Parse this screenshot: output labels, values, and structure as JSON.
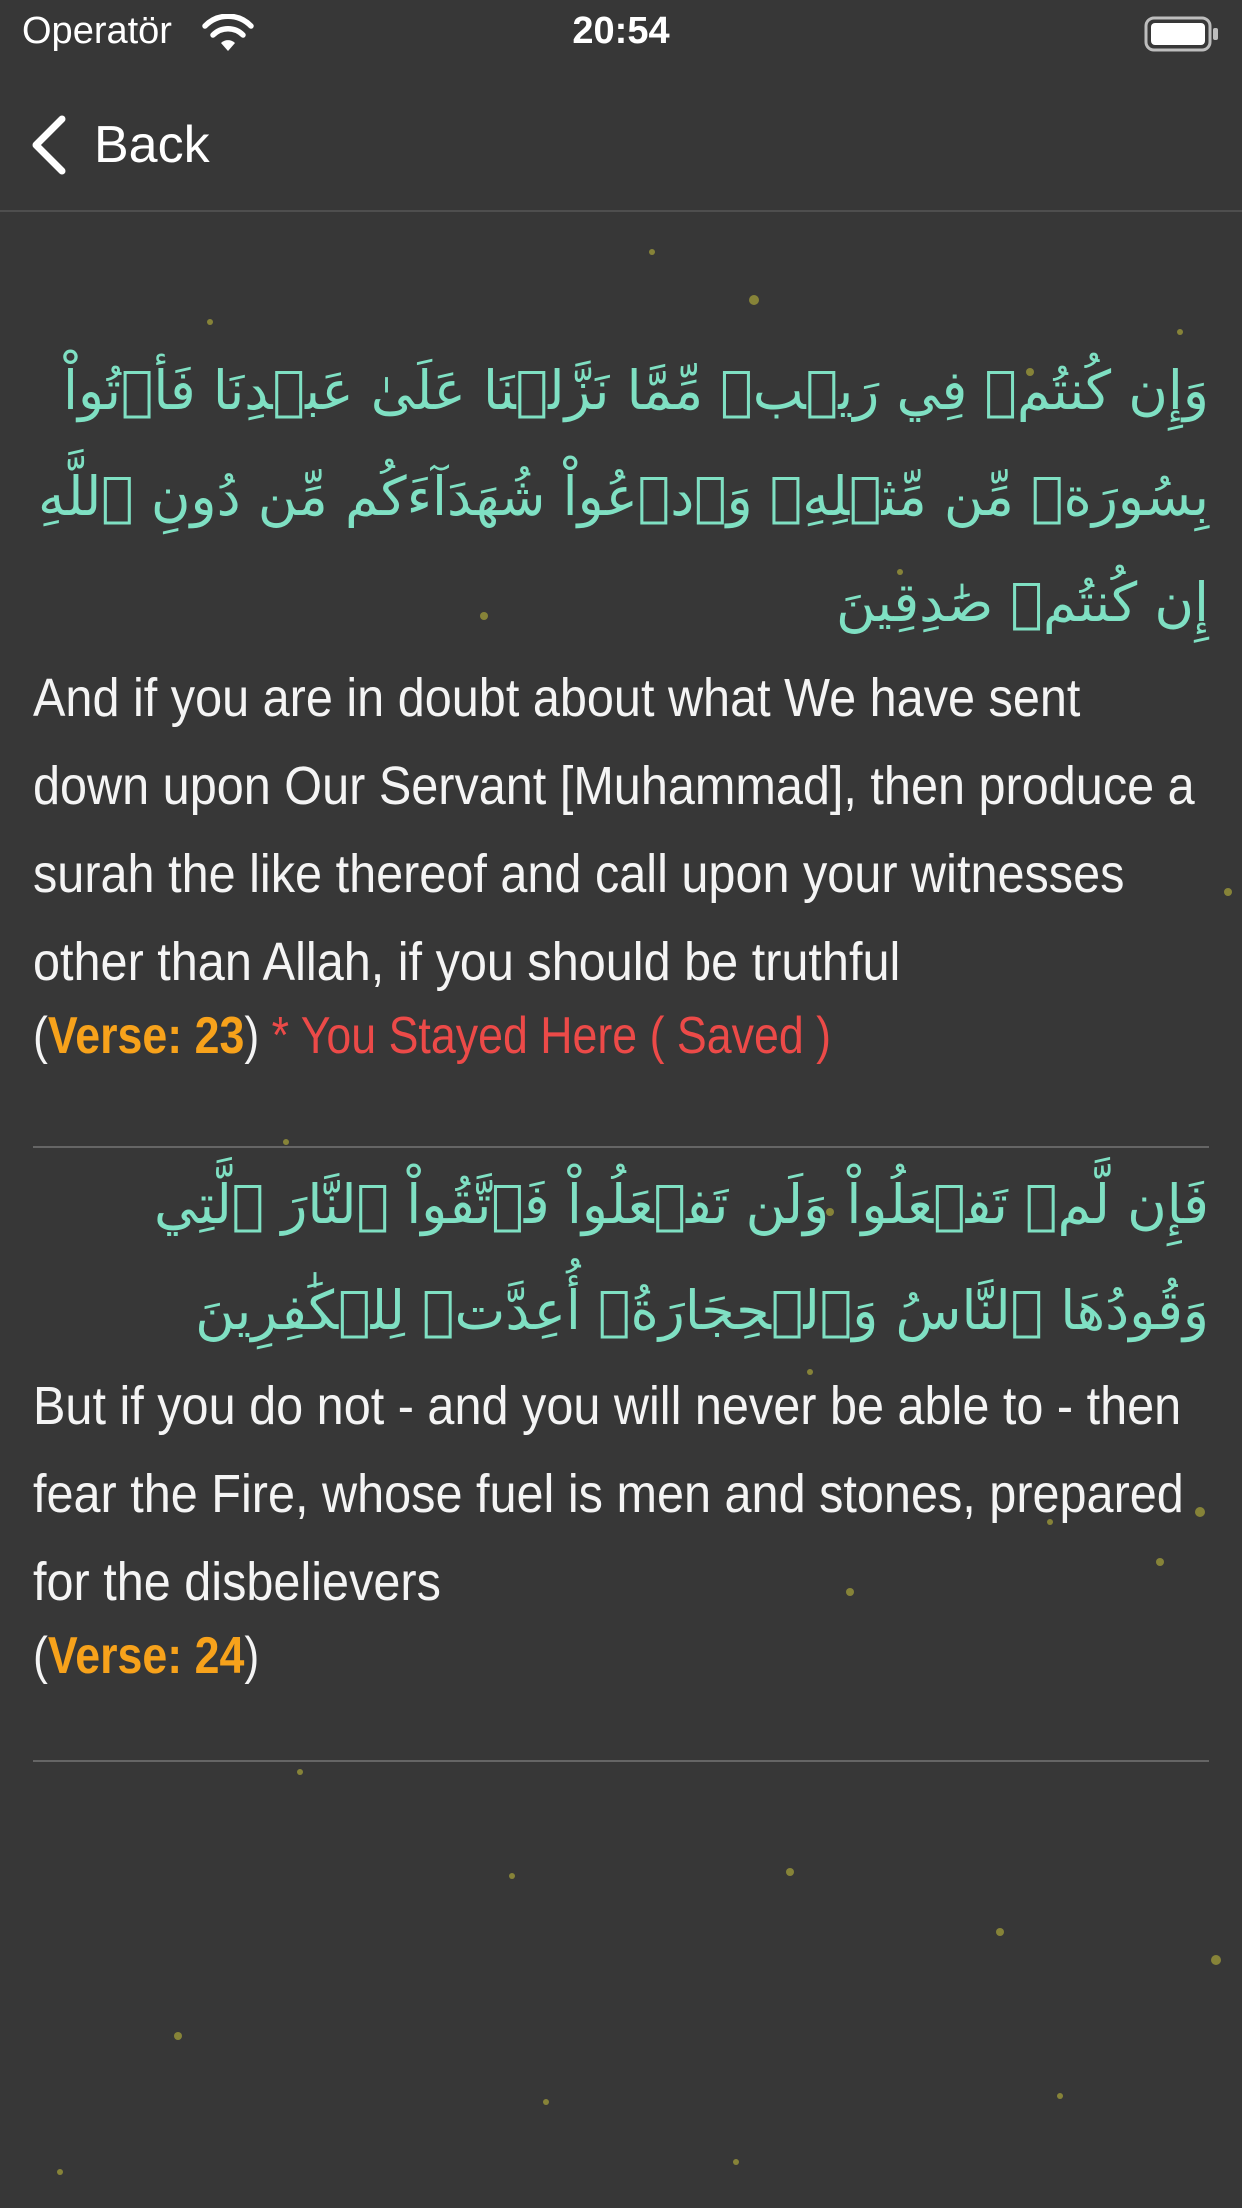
{
  "status_bar": {
    "carrier": "Operatör",
    "time": "20:54"
  },
  "nav": {
    "back_label": "Back"
  },
  "colors": {
    "background": "#373737",
    "arabic_text": "#7fe0c3",
    "verse_number": "#f7a21b",
    "saved_marker": "#ec4a48",
    "translation_text": "#f4f4f4"
  },
  "verses": [
    {
      "arabic": "وَإِن كُنتُمۡ فِي رَيۡبٖ مِّمَّا نَزَّلۡنَا عَلَىٰ عَبۡدِنَا فَأۡتُواْ بِسُورَةٖ مِّن مِّثۡلِهِۦ وَٱدۡعُواْ شُهَدَآءَكُم مِّن دُونِ ٱللَّهِ إِن كُنتُمۡ صَٰدِقِينَ",
      "translation": "And if you are in doubt about what We have sent down upon Our Servant [Muhammad], then produce a surah the like thereof and call upon your witnesses other than Allah, if you should be truthful",
      "open_paren": "(",
      "verse_label": "Verse: 23",
      "close_paren": ")",
      "saved_note": "* You Stayed Here ( Saved )"
    },
    {
      "arabic": "فَإِن لَّمۡ تَفۡعَلُواْ وَلَن تَفۡعَلُواْ فَٱتَّقُواْ ٱلنَّارَ ٱلَّتِي وَقُودُهَا ٱلنَّاسُ وَٱلۡحِجَارَةُۖ أُعِدَّتۡ لِلۡكَٰفِرِينَ",
      "translation": "But if you do not - and you will never be able to - then fear the Fire, whose fuel is men and stones, prepared for the disbelievers",
      "open_paren": "(",
      "verse_label": "Verse: 24",
      "close_paren": ")"
    }
  ]
}
